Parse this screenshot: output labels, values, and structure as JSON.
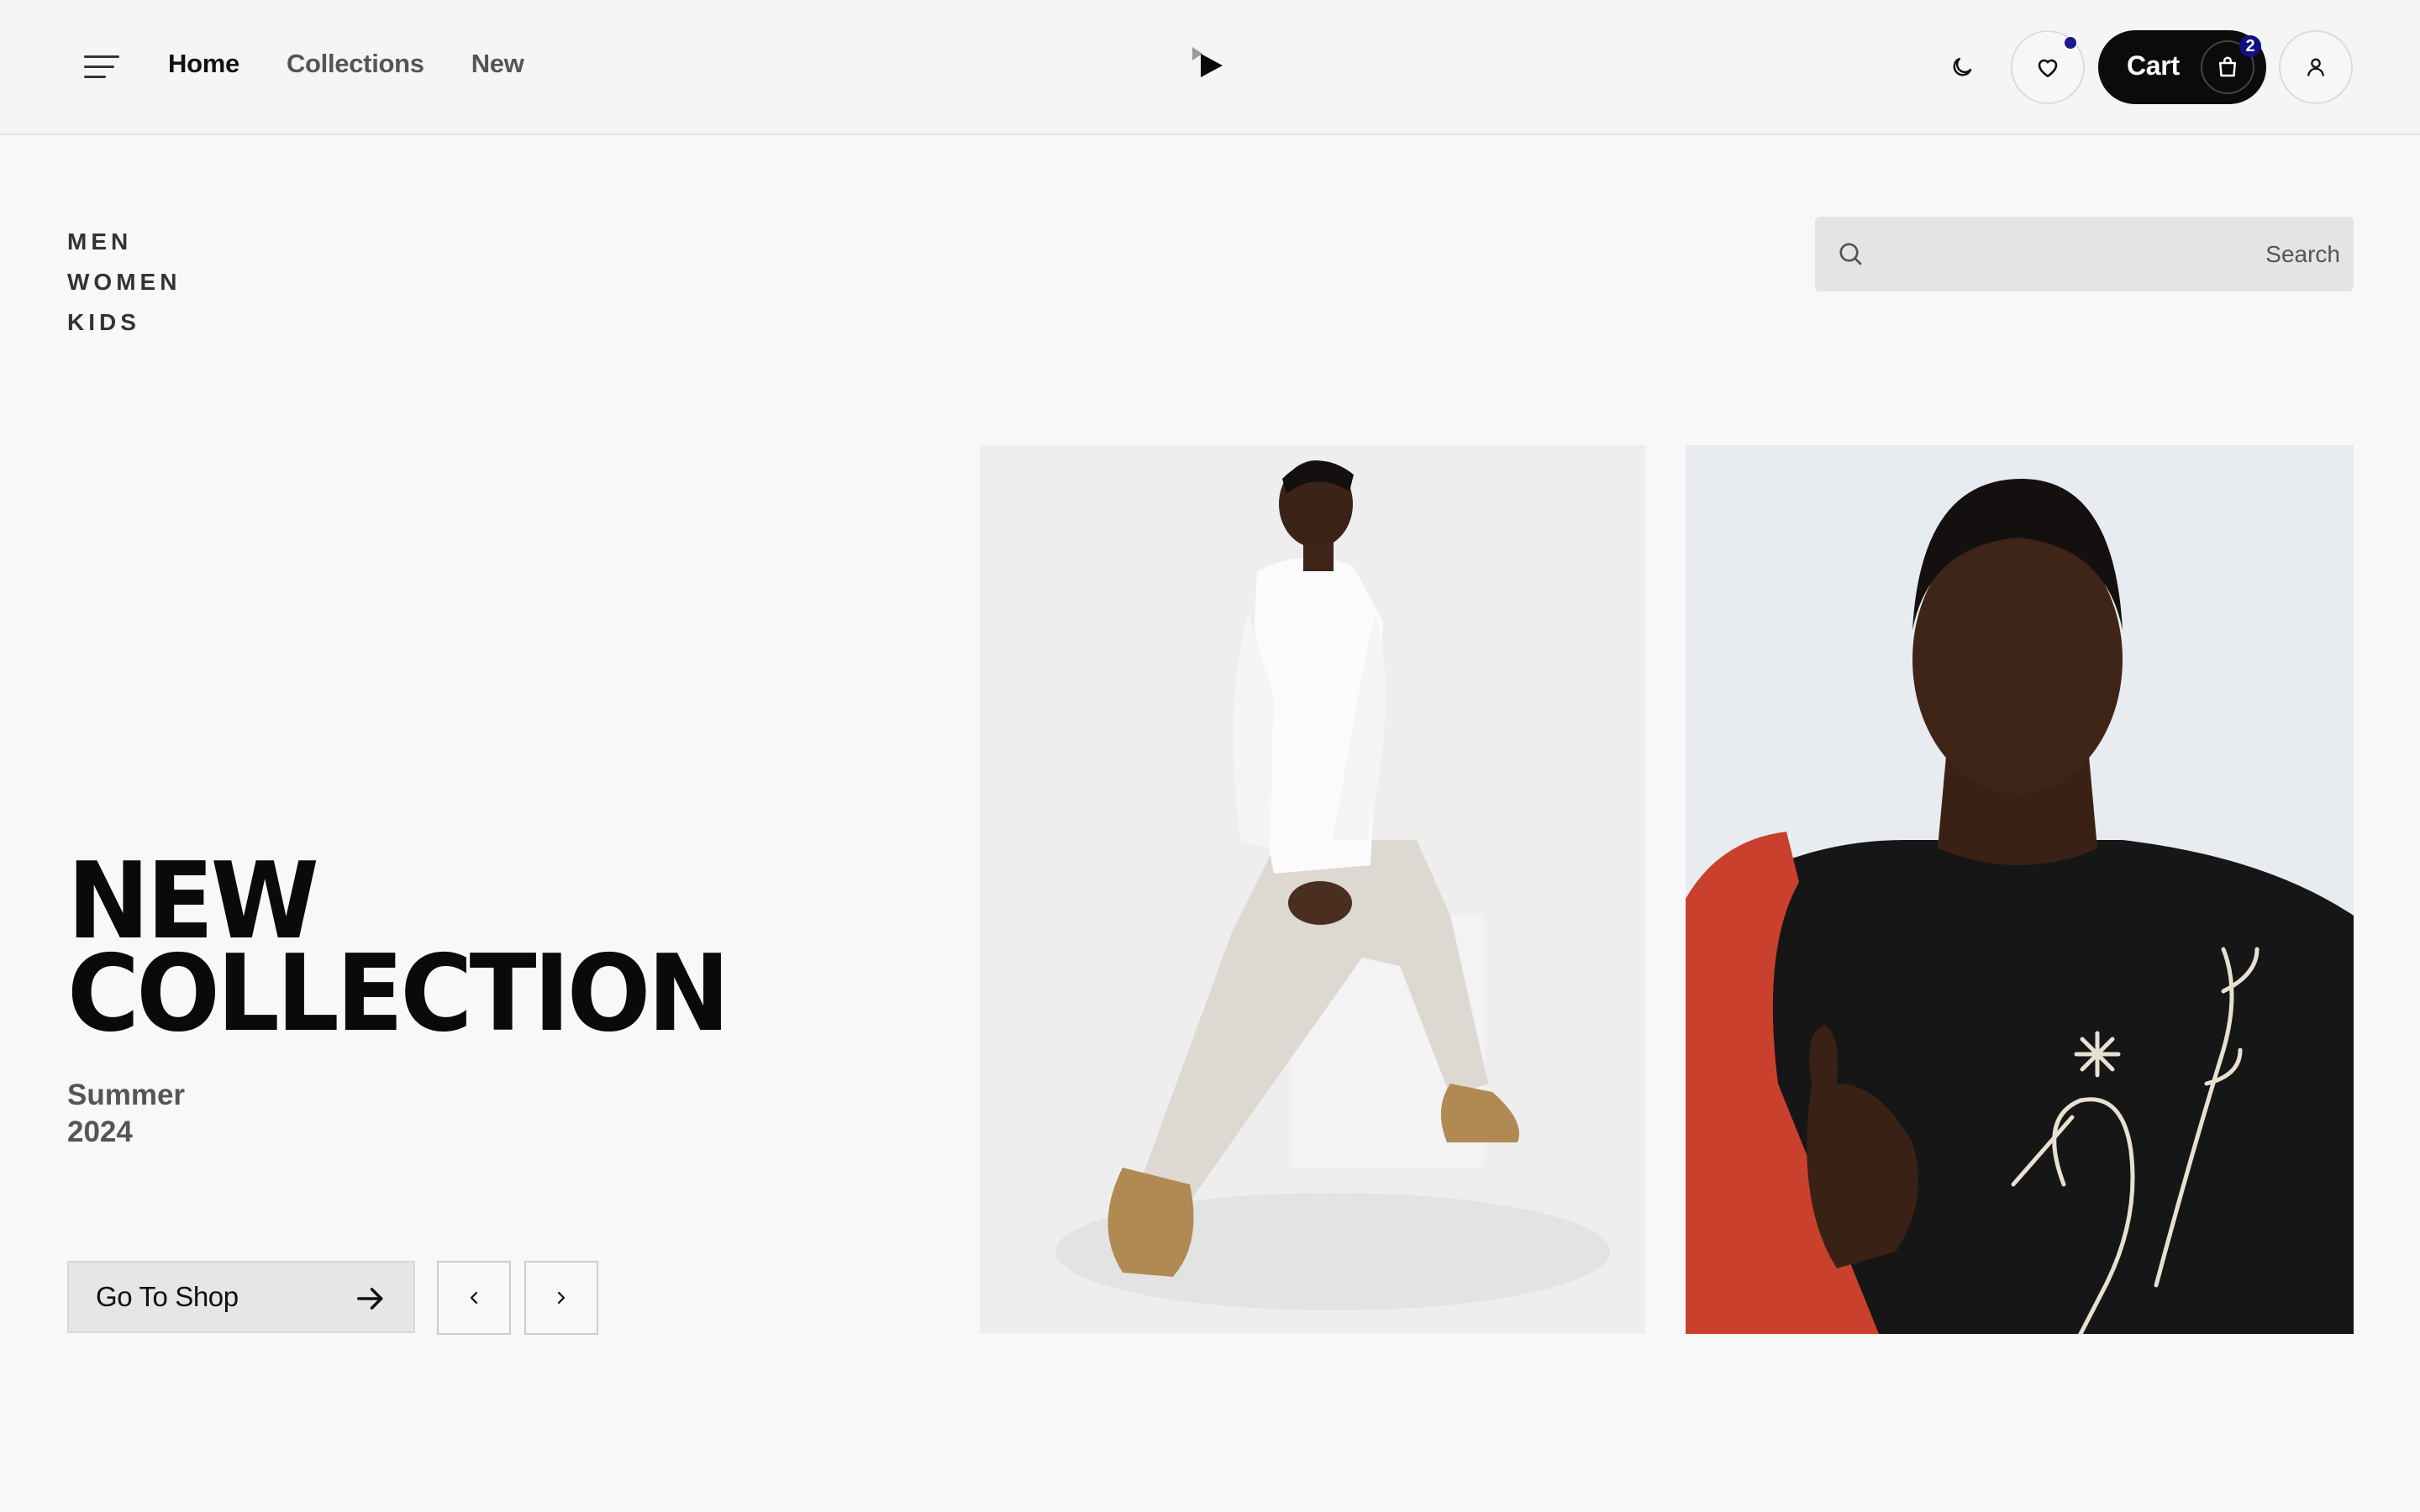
{
  "header": {
    "nav": [
      {
        "label": "Home",
        "active": true
      },
      {
        "label": "Collections",
        "active": false
      },
      {
        "label": "New",
        "active": false
      }
    ],
    "cart_label": "Cart",
    "cart_count": "2",
    "icons": [
      "menu-icon",
      "logo-icon",
      "moon-icon",
      "heart-icon",
      "bag-icon",
      "user-icon"
    ]
  },
  "categories": [
    "MEN",
    "WOMEN",
    "KIDS"
  ],
  "search": {
    "placeholder": "Search"
  },
  "hero": {
    "title_line1": "NEW",
    "title_line2": "COLLECTION",
    "season": "Summer",
    "year": "2024",
    "cta_label": "Go To Shop"
  },
  "colors": {
    "background": "#f8f8f8",
    "cart_button": "#0b0b0b",
    "badge": "#101080",
    "accent_red": "#c9402c"
  }
}
